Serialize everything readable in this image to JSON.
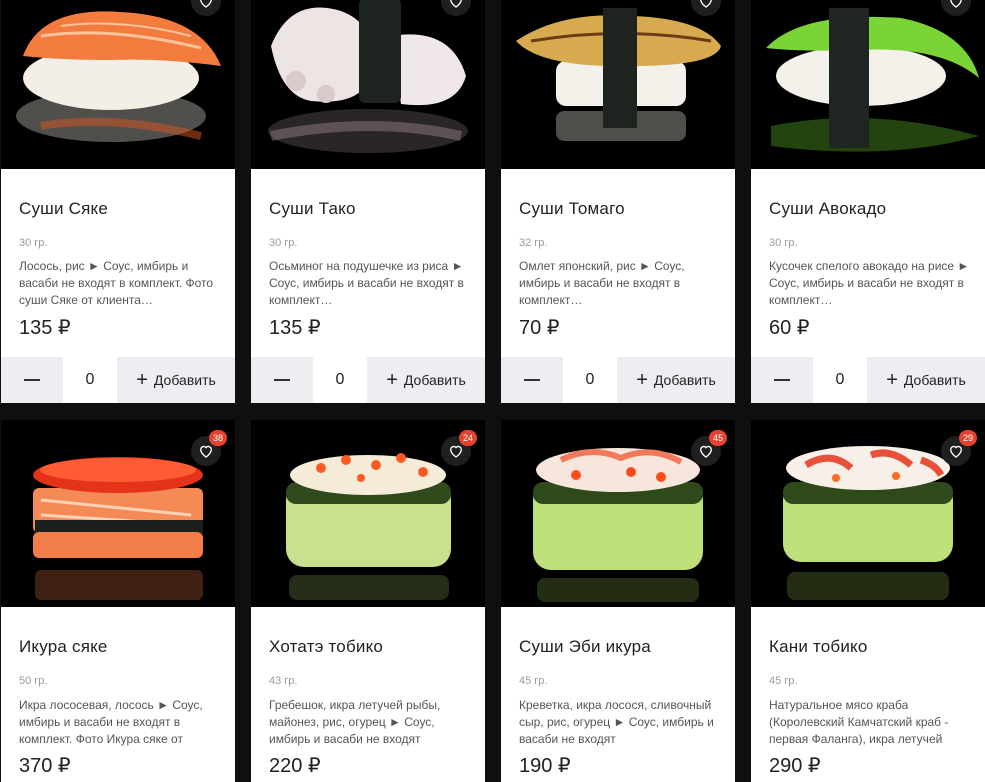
{
  "currency": "₽",
  "add_label": "Добавить",
  "products": [
    {
      "title": "Суши Сяке",
      "weight": "30 гр.",
      "desc": "Лосось, рис ► Соус, имбирь и васаби не входят в комплект. Фото суши Сяке от клиента…",
      "price": "135 ₽",
      "qty": "0",
      "badge": ""
    },
    {
      "title": "Суши Тако",
      "weight": "30 гр.",
      "desc": "Осьминог на подушечке из риса ► Соус, имбирь и васаби не входят в комплект…",
      "price": "135 ₽",
      "qty": "0",
      "badge": ""
    },
    {
      "title": "Суши Томаго",
      "weight": "32 гр.",
      "desc": "Омлет японский, рис ► Соус, имбирь и васаби не входят в комплект…",
      "price": "70 ₽",
      "qty": "0",
      "badge": ""
    },
    {
      "title": "Суши Авокадо",
      "weight": "30 гр.",
      "desc": "Кусочек спелого авокадо на рисе ► Соус, имбирь и васаби не входят в комплект…",
      "price": "60 ₽",
      "qty": "0",
      "badge": ""
    },
    {
      "title": "Икура сяке",
      "weight": "50 гр.",
      "desc": "Икра лососевая, лосось ► Соус, имбирь и васаби не входят в комплект. Фото Икура сяке от",
      "price": "370 ₽",
      "qty": "",
      "badge": "38"
    },
    {
      "title": "Хотатэ тобико",
      "weight": "43 гр.",
      "desc": " Гребешок, икра летучей рыбы, майонез, рис, огурец ► Соус, имбирь и васаби не входят",
      "price": "220 ₽",
      "qty": "",
      "badge": "24"
    },
    {
      "title": "Суши Эби икура",
      "weight": "45 гр.",
      "desc": "Креветка, икра лосося, сливочный сыр, рис, огурец ► Соус, имбирь и васаби не входят",
      "price": "190 ₽",
      "qty": "",
      "badge": "45"
    },
    {
      "title": "Кани тобико",
      "weight": "45 гр.",
      "desc": "Натуральное мясо краба (Королевский Камчатский краб - первая Фаланга), икра летучей",
      "price": "290 ₽",
      "qty": "",
      "badge": "29"
    }
  ],
  "colors": {
    "badge": "#e5432f",
    "button_bg": "#eceef1",
    "page_bg": "#0f0f0f"
  }
}
